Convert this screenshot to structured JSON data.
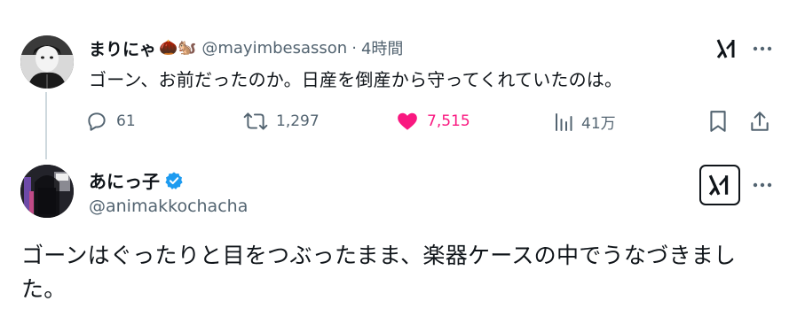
{
  "reply_tweet": {
    "author_name": "まりにゃ",
    "name_emojis": "🌰🐿️",
    "handle": "@mayimbesasson",
    "separator": "·",
    "time": "4時間",
    "text": "ゴーン、お前だったのか。日産を倒産から守ってくれていたのは。",
    "stats": {
      "replies": "61",
      "retweets": "1,297",
      "likes": "7,515",
      "views": "41万"
    },
    "colors": {
      "like": "#f91880",
      "muted": "#536471"
    }
  },
  "quoted_tweet": {
    "author_name": "あにっ子",
    "handle": "@animakkochacha",
    "verified": true,
    "text": "ゴーンはぐったりと目をつぶったまま、楽器ケースの中でうなづきました。",
    "colors": {
      "verified": "#1d9bf0"
    }
  }
}
